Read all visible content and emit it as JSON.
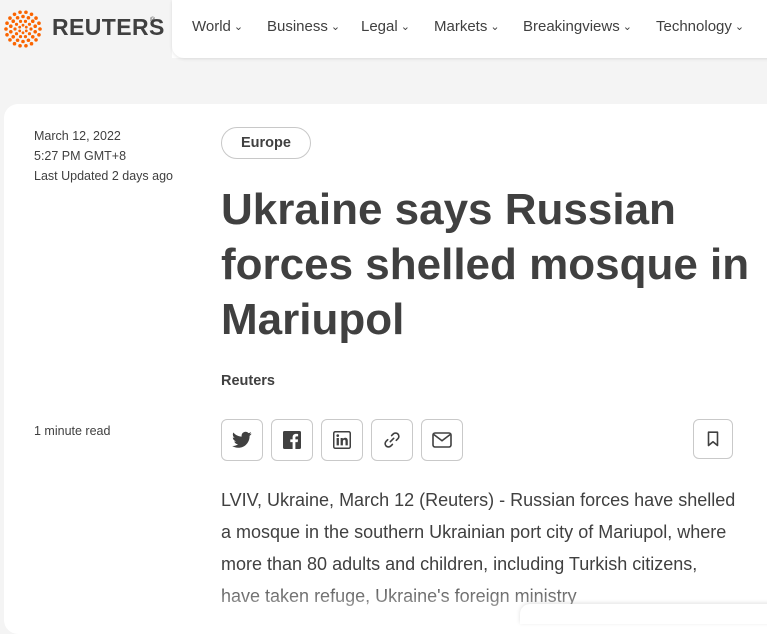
{
  "brand": {
    "name": "REUTERS",
    "registered_mark": "®",
    "logo_icon": "reuters-dots-logo-icon",
    "accent_color": "#fa6400"
  },
  "nav": {
    "items": [
      {
        "label": "World"
      },
      {
        "label": "Business"
      },
      {
        "label": "Legal"
      },
      {
        "label": "Markets"
      },
      {
        "label": "Breakingviews"
      },
      {
        "label": "Technology"
      }
    ],
    "chevron": "⌄"
  },
  "article": {
    "date": "March 12, 2022",
    "time": "5:27 PM GMT+8",
    "last_updated": "Last Updated 2 days ago",
    "read_time": "1 minute read",
    "tag": "Europe",
    "headline": "Ukraine says Russian forces shelled mosque in Mariupol",
    "byline": "Reuters",
    "share_icons": [
      "twitter-icon",
      "facebook-icon",
      "linkedin-icon",
      "link-icon",
      "email-icon"
    ],
    "bookmark_icon": "bookmark-icon",
    "body": "LVIV, Ukraine, March 12 (Reuters) - Russian forces have shelled a mosque in the southern Ukrainian port city of Mariupol, where more than 80 adults and children, including Turkish citizens, have taken refuge, Ukraine's foreign ministry"
  }
}
